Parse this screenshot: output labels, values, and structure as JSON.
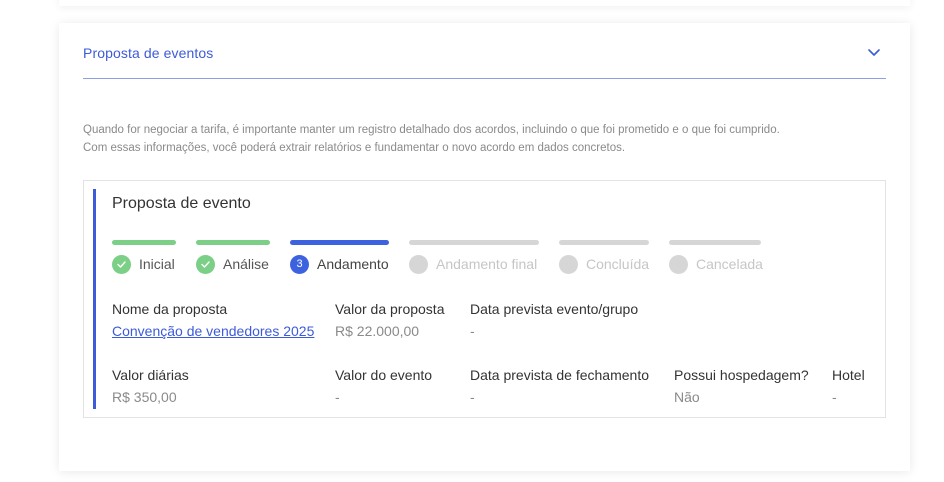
{
  "accordion": {
    "title": "Proposta de eventos",
    "toggle_icon": "chevron-down-icon",
    "accent_color": "#3d5bd8"
  },
  "intro": {
    "line1": "Quando for negociar a tarifa, é importante manter um registro detalhado dos acordos, incluindo o que foi prometido e o que foi cumprido.",
    "line2": "Com essas informações, você poderá extrair relatórios e fundamentar o novo acordo em dados concretos."
  },
  "proposal": {
    "title": "Proposta de evento",
    "steps": [
      {
        "label": "Inicial",
        "status": "done",
        "icon": "check-icon"
      },
      {
        "label": "Análise",
        "status": "done",
        "icon": "check-icon"
      },
      {
        "label": "Andamento",
        "status": "current",
        "number": "3"
      },
      {
        "label": "Andamento final",
        "status": "todo"
      },
      {
        "label": "Concluída",
        "status": "todo"
      },
      {
        "label": "Cancelada",
        "status": "todo"
      }
    ],
    "status_colors": {
      "done": "#7bcf86",
      "current": "#3d62e0",
      "todo": "#d6d6d6"
    },
    "fields": {
      "nome": {
        "label": "Nome da proposta",
        "value": "Convenção de vendedores 2025"
      },
      "valor_proposta": {
        "label": "Valor da proposta",
        "value": "R$ 22.000,00"
      },
      "data_evento": {
        "label": "Data prevista evento/grupo",
        "value": "-"
      },
      "valor_diarias": {
        "label": "Valor diárias",
        "value": "R$ 350,00"
      },
      "valor_evento": {
        "label": "Valor do evento",
        "value": "-"
      },
      "data_fechamento": {
        "label": "Data prevista de fechamento",
        "value": "-"
      },
      "hospedagem": {
        "label": "Possui hospedagem?",
        "value": "Não"
      },
      "hotel": {
        "label": "Hotel",
        "value": "-"
      }
    }
  }
}
